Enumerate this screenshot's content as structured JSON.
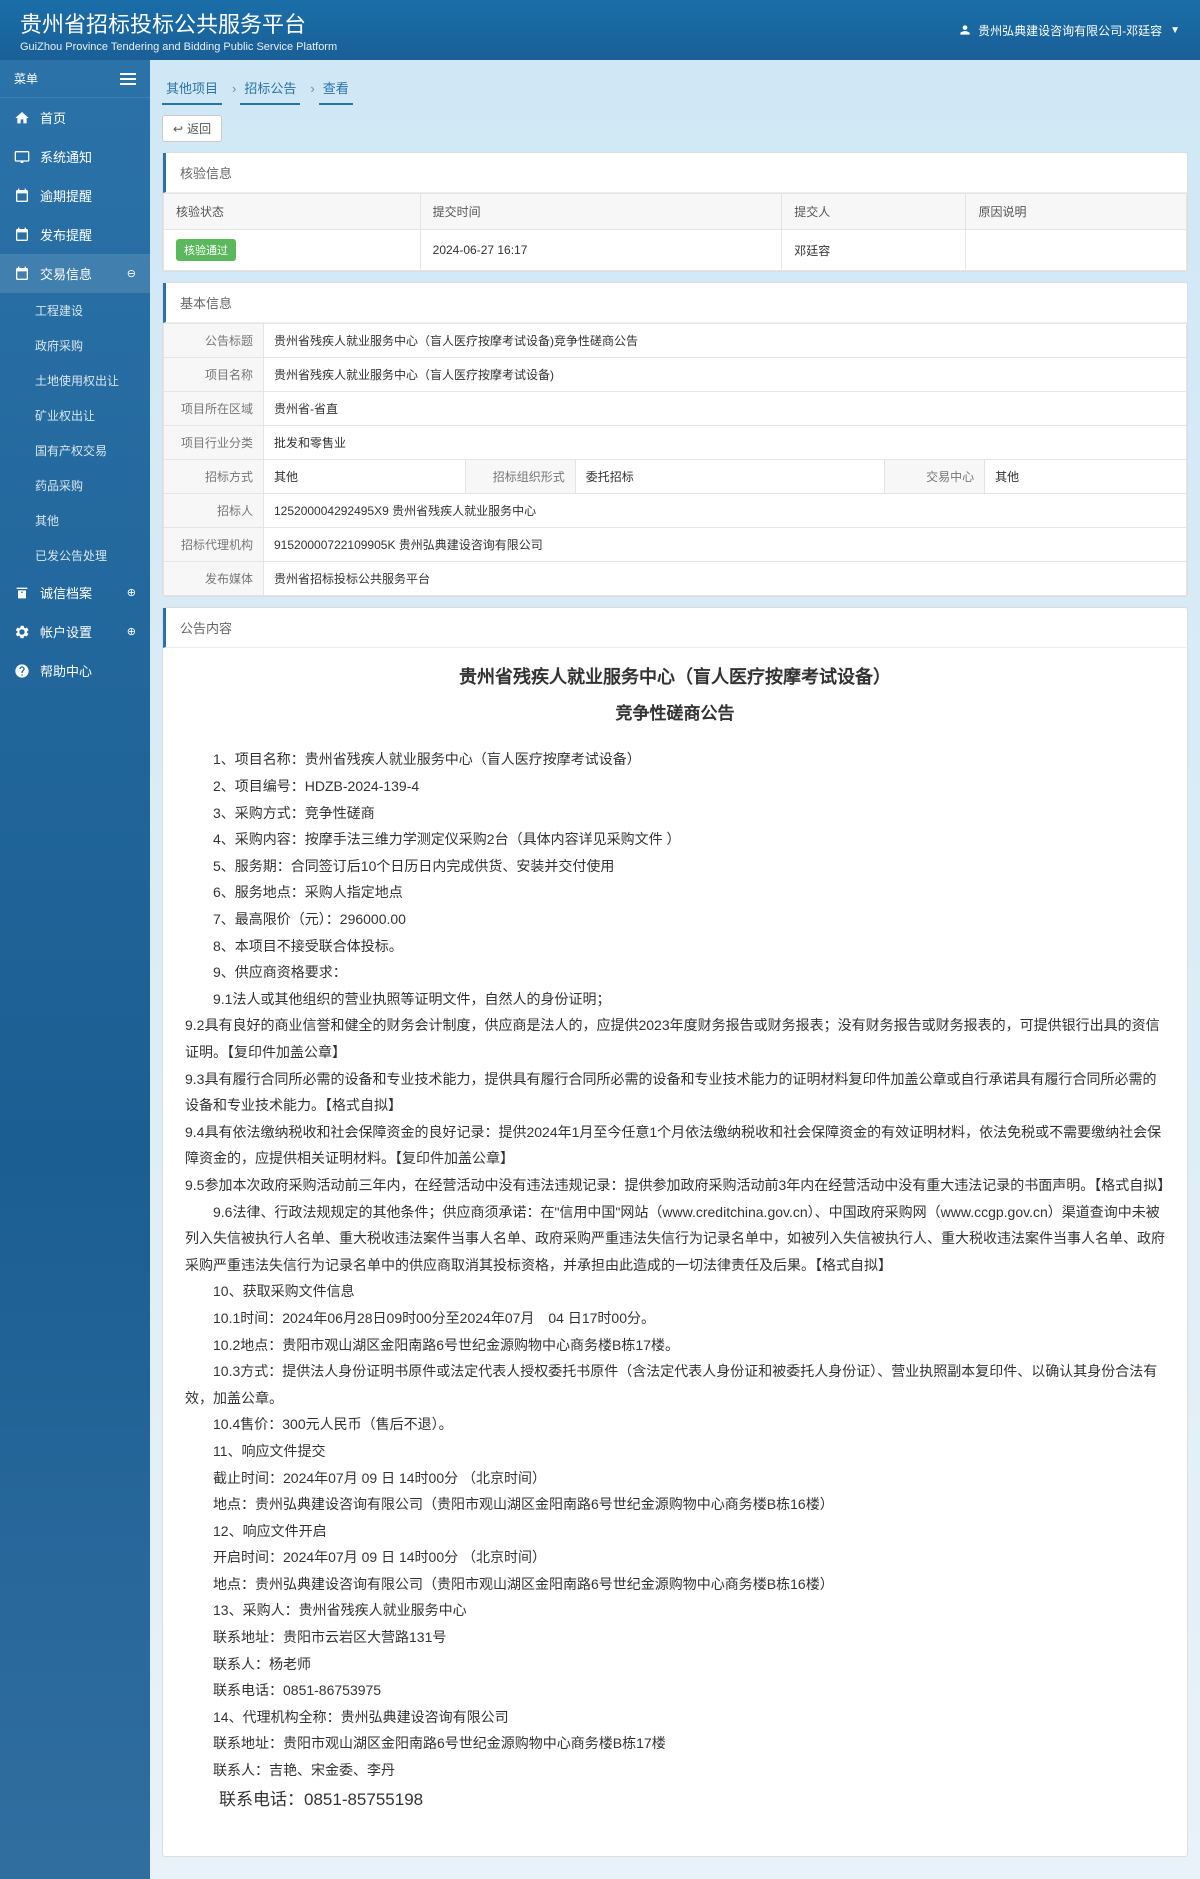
{
  "header": {
    "title": "贵州省招标投标公共服务平台",
    "subtitle": "GuiZhou Province Tendering and Bidding Public Service Platform",
    "user_company": "贵州弘典建设咨询有限公司-邓廷容"
  },
  "sidebar": {
    "menu_label": "菜单",
    "items": [
      {
        "icon": "home",
        "label": "首页"
      },
      {
        "icon": "monitor",
        "label": "系统通知"
      },
      {
        "icon": "calendar",
        "label": "逾期提醒"
      },
      {
        "icon": "calendar",
        "label": "发布提醒"
      },
      {
        "icon": "calendar",
        "label": "交易信息",
        "expanded": true
      }
    ],
    "subitems": [
      "工程建设",
      "政府采购",
      "土地使用权出让",
      "矿业权出让",
      "国有产权交易",
      "药品采购",
      "其他",
      "已发公告处理"
    ],
    "items_bottom": [
      {
        "icon": "archive",
        "label": "诚信档案"
      },
      {
        "icon": "settings",
        "label": "帐户设置"
      },
      {
        "icon": "help",
        "label": "帮助中心"
      }
    ]
  },
  "breadcrumb": {
    "items": [
      "其他项目",
      "招标公告",
      "查看"
    ],
    "back_label": "返回"
  },
  "verify": {
    "panel_title": "核验信息",
    "headers": [
      "核验状态",
      "提交时间",
      "提交人",
      "原因说明"
    ],
    "row": {
      "status": "核验通过",
      "time": "2024-06-27 16:17",
      "submitter": "邓廷容",
      "reason": ""
    }
  },
  "basic": {
    "panel_title": "基本信息",
    "fields": {
      "title_label": "公告标题",
      "title_value": "贵州省残疾人就业服务中心（盲人医疗按摩考试设备)竞争性磋商公告",
      "project_label": "项目名称",
      "project_value": "贵州省残疾人就业服务中心（盲人医疗按摩考试设备)",
      "area_label": "项目所在区域",
      "area_value": "贵州省-省直",
      "industry_label": "项目行业分类",
      "industry_value": "批发和零售业",
      "bid_method_label": "招标方式",
      "bid_method_value": "其他",
      "org_form_label": "招标组织形式",
      "org_form_value": "委托招标",
      "trade_center_label": "交易中心",
      "trade_center_value": "其他",
      "bidder_label": "招标人",
      "bidder_value": "125200004292495X9 贵州省残疾人就业服务中心",
      "agency_label": "招标代理机构",
      "agency_value": "91520000722109905K 贵州弘典建设咨询有限公司",
      "media_label": "发布媒体",
      "media_value": "贵州省招标投标公共服务平台"
    }
  },
  "content": {
    "panel_title": "公告内容",
    "main_title": "贵州省残疾人就业服务中心（盲人医疗按摩考试设备）",
    "sub_title": "竞争性磋商公告",
    "paragraphs": [
      "1、项目名称：贵州省残疾人就业服务中心（盲人医疗按摩考试设备）",
      "2、项目编号：HDZB-2024-139-4",
      "3、采购方式：竞争性磋商",
      "4、采购内容：按摩手法三维力学测定仪采购2台（具体内容详见采购文件 ）",
      "5、服务期：合同签订后10个日历日内完成供货、安装并交付使用",
      "6、服务地点：采购人指定地点",
      "7、最高限价（元）：296000.00",
      "8、本项目不接受联合体投标。",
      "9、供应商资格要求：",
      "9.1法人或其他组织的营业执照等证明文件，自然人的身份证明；",
      "9.2具有良好的商业信誉和健全的财务会计制度，供应商是法人的，应提供2023年度财务报告或财务报表；没有财务报告或财务报表的，可提供银行出具的资信证明。【复印件加盖公章】",
      "9.3具有履行合同所必需的设备和专业技术能力，提供具有履行合同所必需的设备和专业技术能力的证明材料复印件加盖公章或自行承诺具有履行合同所必需的设备和专业技术能力。【格式自拟】",
      "9.4具有依法缴纳税收和社会保障资金的良好记录：提供2024年1月至今任意1个月依法缴纳税收和社会保障资金的有效证明材料，依法免税或不需要缴纳社会保障资金的，应提供相关证明材料。【复印件加盖公章】",
      "9.5参加本次政府采购活动前三年内，在经营活动中没有违法违规记录：提供参加政府采购活动前3年内在经营活动中没有重大违法记录的书面声明。【格式自拟】",
      "9.6法律、行政法规规定的其他条件；供应商须承诺：在\"信用中国\"网站（www.creditchina.gov.cn）、中国政府采购网（www.ccgp.gov.cn）渠道查询中未被列入失信被执行人名单、重大税收违法案件当事人名单、政府采购严重违法失信行为记录名单中，如被列入失信被执行人、重大税收违法案件当事人名单、政府采购严重违法失信行为记录名单中的供应商取消其投标资格，并承担由此造成的一切法律责任及后果。【格式自拟】",
      "10、获取采购文件信息",
      "10.1时间：2024年06月28日09时00分至2024年07月　04 日17时00分。",
      "10.2地点：贵阳市观山湖区金阳南路6号世纪金源购物中心商务楼B栋17楼。",
      "10.3方式：提供法人身份证明书原件或法定代表人授权委托书原件（含法定代表人身份证和被委托人身份证）、营业执照副本复印件、以确认其身份合法有效，加盖公章。",
      "10.4售价：300元人民币（售后不退）。",
      "11、响应文件提交",
      "截止时间：2024年07月 09 日 14时00分  （北京时间）",
      "地点：贵州弘典建设咨询有限公司（贵阳市观山湖区金阳南路6号世纪金源购物中心商务楼B栋16楼）",
      "12、响应文件开启",
      "开启时间：2024年07月 09 日 14时00分  （北京时间）",
      "地点：贵州弘典建设咨询有限公司（贵阳市观山湖区金阳南路6号世纪金源购物中心商务楼B栋16楼）",
      "13、采购人：贵州省残疾人就业服务中心",
      "联系地址：贵阳市云岩区大营路131号",
      "联系人：杨老师",
      "联系电话：0851-86753975",
      "14、代理机构全称：贵州弘典建设咨询有限公司",
      "联系地址：贵阳市观山湖区金阳南路6号世纪金源购物中心商务楼B栋17楼",
      "联系人：吉艳、宋金委、李丹"
    ],
    "phone_line": "联系电话：0851-85755198"
  }
}
